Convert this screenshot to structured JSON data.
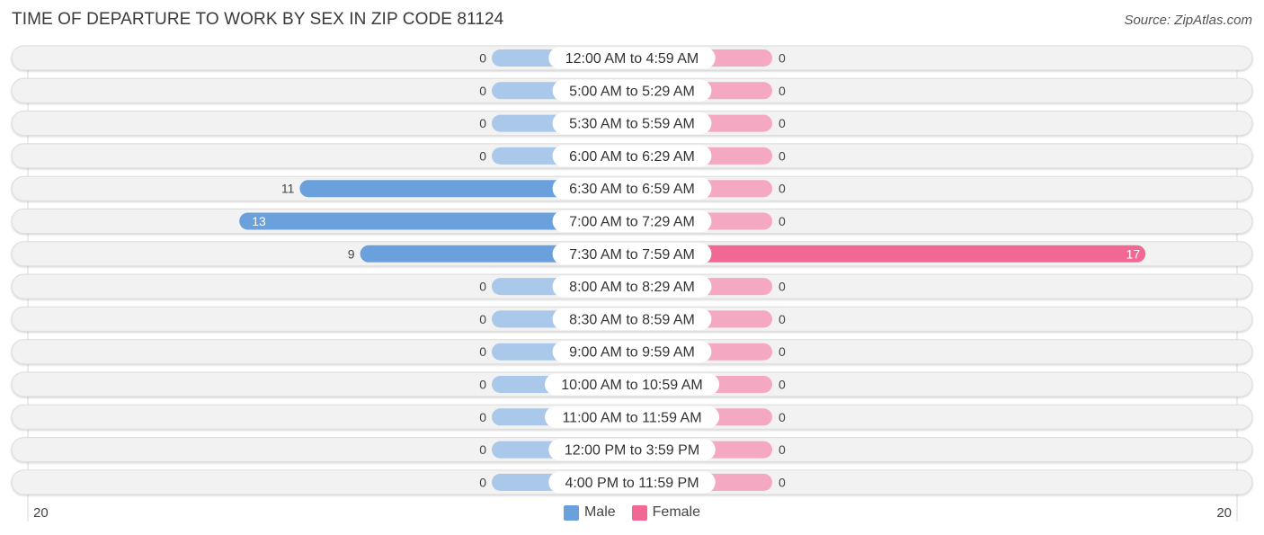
{
  "title": "TIME OF DEPARTURE TO WORK BY SEX IN ZIP CODE 81124",
  "source": "Source: ZipAtlas.com",
  "colors": {
    "male_strong": "#6aa1dc",
    "male_light": "#a9c8ea",
    "female_strong": "#f06893",
    "female_light": "#f5a8c1",
    "row_bg": "#f2f2f2",
    "label_bg": "#ffffff"
  },
  "legend": [
    {
      "label": "Male",
      "color": "#6aa1dc"
    },
    {
      "label": "Female",
      "color": "#f06893"
    }
  ],
  "axis": {
    "left_label": "20",
    "right_label": "20"
  },
  "chart_data": {
    "type": "bar",
    "orientation": "horizontal-diverging",
    "title": "TIME OF DEPARTURE TO WORK BY SEX IN ZIP CODE 81124",
    "categories": [
      "12:00 AM to 4:59 AM",
      "5:00 AM to 5:29 AM",
      "5:30 AM to 5:59 AM",
      "6:00 AM to 6:29 AM",
      "6:30 AM to 6:59 AM",
      "7:00 AM to 7:29 AM",
      "7:30 AM to 7:59 AM",
      "8:00 AM to 8:29 AM",
      "8:30 AM to 8:59 AM",
      "9:00 AM to 9:59 AM",
      "10:00 AM to 10:59 AM",
      "11:00 AM to 11:59 AM",
      "12:00 PM to 3:59 PM",
      "4:00 PM to 11:59 PM"
    ],
    "series": [
      {
        "name": "Male",
        "values": [
          0,
          0,
          0,
          0,
          11,
          13,
          9,
          0,
          0,
          0,
          0,
          0,
          0,
          0
        ]
      },
      {
        "name": "Female",
        "values": [
          0,
          0,
          0,
          0,
          0,
          0,
          17,
          0,
          0,
          0,
          0,
          0,
          0,
          0
        ]
      }
    ],
    "xlim": [
      -20,
      20
    ],
    "xlabel": "",
    "ylabel": "",
    "legend_position": "bottom-center",
    "grid": false
  }
}
